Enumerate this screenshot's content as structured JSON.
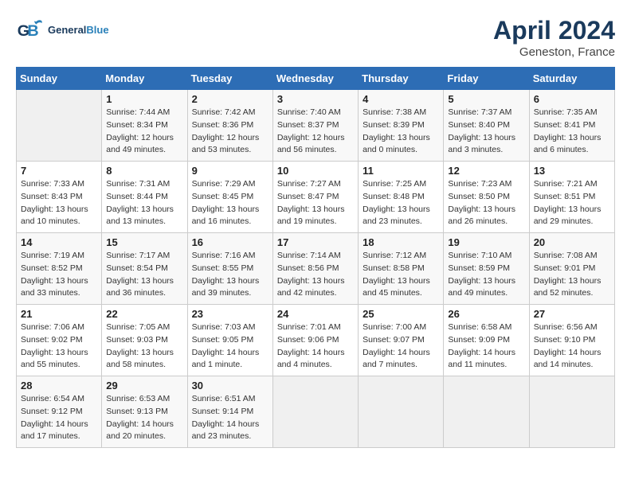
{
  "header": {
    "logo_general": "General",
    "logo_blue": "Blue",
    "month": "April 2024",
    "location": "Geneston, France"
  },
  "calendar": {
    "days_of_week": [
      "Sunday",
      "Monday",
      "Tuesday",
      "Wednesday",
      "Thursday",
      "Friday",
      "Saturday"
    ],
    "weeks": [
      [
        {
          "day": "",
          "info": ""
        },
        {
          "day": "1",
          "info": "Sunrise: 7:44 AM\nSunset: 8:34 PM\nDaylight: 12 hours\nand 49 minutes."
        },
        {
          "day": "2",
          "info": "Sunrise: 7:42 AM\nSunset: 8:36 PM\nDaylight: 12 hours\nand 53 minutes."
        },
        {
          "day": "3",
          "info": "Sunrise: 7:40 AM\nSunset: 8:37 PM\nDaylight: 12 hours\nand 56 minutes."
        },
        {
          "day": "4",
          "info": "Sunrise: 7:38 AM\nSunset: 8:39 PM\nDaylight: 13 hours\nand 0 minutes."
        },
        {
          "day": "5",
          "info": "Sunrise: 7:37 AM\nSunset: 8:40 PM\nDaylight: 13 hours\nand 3 minutes."
        },
        {
          "day": "6",
          "info": "Sunrise: 7:35 AM\nSunset: 8:41 PM\nDaylight: 13 hours\nand 6 minutes."
        }
      ],
      [
        {
          "day": "7",
          "info": "Sunrise: 7:33 AM\nSunset: 8:43 PM\nDaylight: 13 hours\nand 10 minutes."
        },
        {
          "day": "8",
          "info": "Sunrise: 7:31 AM\nSunset: 8:44 PM\nDaylight: 13 hours\nand 13 minutes."
        },
        {
          "day": "9",
          "info": "Sunrise: 7:29 AM\nSunset: 8:45 PM\nDaylight: 13 hours\nand 16 minutes."
        },
        {
          "day": "10",
          "info": "Sunrise: 7:27 AM\nSunset: 8:47 PM\nDaylight: 13 hours\nand 19 minutes."
        },
        {
          "day": "11",
          "info": "Sunrise: 7:25 AM\nSunset: 8:48 PM\nDaylight: 13 hours\nand 23 minutes."
        },
        {
          "day": "12",
          "info": "Sunrise: 7:23 AM\nSunset: 8:50 PM\nDaylight: 13 hours\nand 26 minutes."
        },
        {
          "day": "13",
          "info": "Sunrise: 7:21 AM\nSunset: 8:51 PM\nDaylight: 13 hours\nand 29 minutes."
        }
      ],
      [
        {
          "day": "14",
          "info": "Sunrise: 7:19 AM\nSunset: 8:52 PM\nDaylight: 13 hours\nand 33 minutes."
        },
        {
          "day": "15",
          "info": "Sunrise: 7:17 AM\nSunset: 8:54 PM\nDaylight: 13 hours\nand 36 minutes."
        },
        {
          "day": "16",
          "info": "Sunrise: 7:16 AM\nSunset: 8:55 PM\nDaylight: 13 hours\nand 39 minutes."
        },
        {
          "day": "17",
          "info": "Sunrise: 7:14 AM\nSunset: 8:56 PM\nDaylight: 13 hours\nand 42 minutes."
        },
        {
          "day": "18",
          "info": "Sunrise: 7:12 AM\nSunset: 8:58 PM\nDaylight: 13 hours\nand 45 minutes."
        },
        {
          "day": "19",
          "info": "Sunrise: 7:10 AM\nSunset: 8:59 PM\nDaylight: 13 hours\nand 49 minutes."
        },
        {
          "day": "20",
          "info": "Sunrise: 7:08 AM\nSunset: 9:01 PM\nDaylight: 13 hours\nand 52 minutes."
        }
      ],
      [
        {
          "day": "21",
          "info": "Sunrise: 7:06 AM\nSunset: 9:02 PM\nDaylight: 13 hours\nand 55 minutes."
        },
        {
          "day": "22",
          "info": "Sunrise: 7:05 AM\nSunset: 9:03 PM\nDaylight: 13 hours\nand 58 minutes."
        },
        {
          "day": "23",
          "info": "Sunrise: 7:03 AM\nSunset: 9:05 PM\nDaylight: 14 hours\nand 1 minute."
        },
        {
          "day": "24",
          "info": "Sunrise: 7:01 AM\nSunset: 9:06 PM\nDaylight: 14 hours\nand 4 minutes."
        },
        {
          "day": "25",
          "info": "Sunrise: 7:00 AM\nSunset: 9:07 PM\nDaylight: 14 hours\nand 7 minutes."
        },
        {
          "day": "26",
          "info": "Sunrise: 6:58 AM\nSunset: 9:09 PM\nDaylight: 14 hours\nand 11 minutes."
        },
        {
          "day": "27",
          "info": "Sunrise: 6:56 AM\nSunset: 9:10 PM\nDaylight: 14 hours\nand 14 minutes."
        }
      ],
      [
        {
          "day": "28",
          "info": "Sunrise: 6:54 AM\nSunset: 9:12 PM\nDaylight: 14 hours\nand 17 minutes."
        },
        {
          "day": "29",
          "info": "Sunrise: 6:53 AM\nSunset: 9:13 PM\nDaylight: 14 hours\nand 20 minutes."
        },
        {
          "day": "30",
          "info": "Sunrise: 6:51 AM\nSunset: 9:14 PM\nDaylight: 14 hours\nand 23 minutes."
        },
        {
          "day": "",
          "info": ""
        },
        {
          "day": "",
          "info": ""
        },
        {
          "day": "",
          "info": ""
        },
        {
          "day": "",
          "info": ""
        }
      ]
    ]
  }
}
